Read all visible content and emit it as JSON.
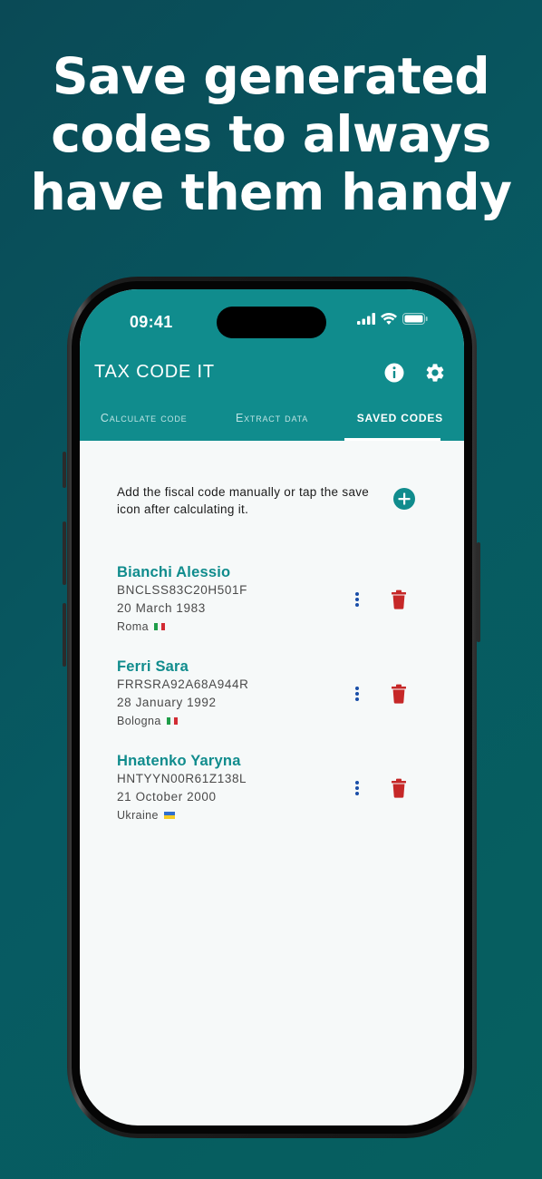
{
  "headline": [
    "Save generated",
    "codes to always",
    "have them handy"
  ],
  "status_bar": {
    "time": "09:41"
  },
  "app": {
    "title": "TAX CODE IT",
    "info_icon": "info-icon",
    "settings_icon": "gear-icon"
  },
  "tabs": [
    {
      "label": "Calculate code",
      "active": false
    },
    {
      "label": "Extract data",
      "active": false
    },
    {
      "label": "Saved codes",
      "active": true
    }
  ],
  "intro": {
    "text": "Add the fiscal code manually or tap the save icon after calculating it.",
    "add_icon": "add-circle-icon"
  },
  "entries": [
    {
      "name": "Bianchi Alessio",
      "code": "BNCLSS83C20H501F",
      "dob": "20 March 1983",
      "place": "Roma",
      "flag": "italy-flag"
    },
    {
      "name": "Ferri Sara",
      "code": "FRRSRA92A68A944R",
      "dob": "28 January 1992",
      "place": "Bologna",
      "flag": "italy-flag"
    },
    {
      "name": "Hnatenko Yaryna",
      "code": "HNTYYN00R61Z138L",
      "dob": "21 October 2000",
      "place": "Ukraine",
      "flag": "ukraine-flag"
    }
  ],
  "colors": {
    "primary": "#108c8d",
    "delete": "#c62828",
    "menu": "#1a4ea8",
    "background_from": "#0a4a56",
    "background_to": "#06605f"
  }
}
